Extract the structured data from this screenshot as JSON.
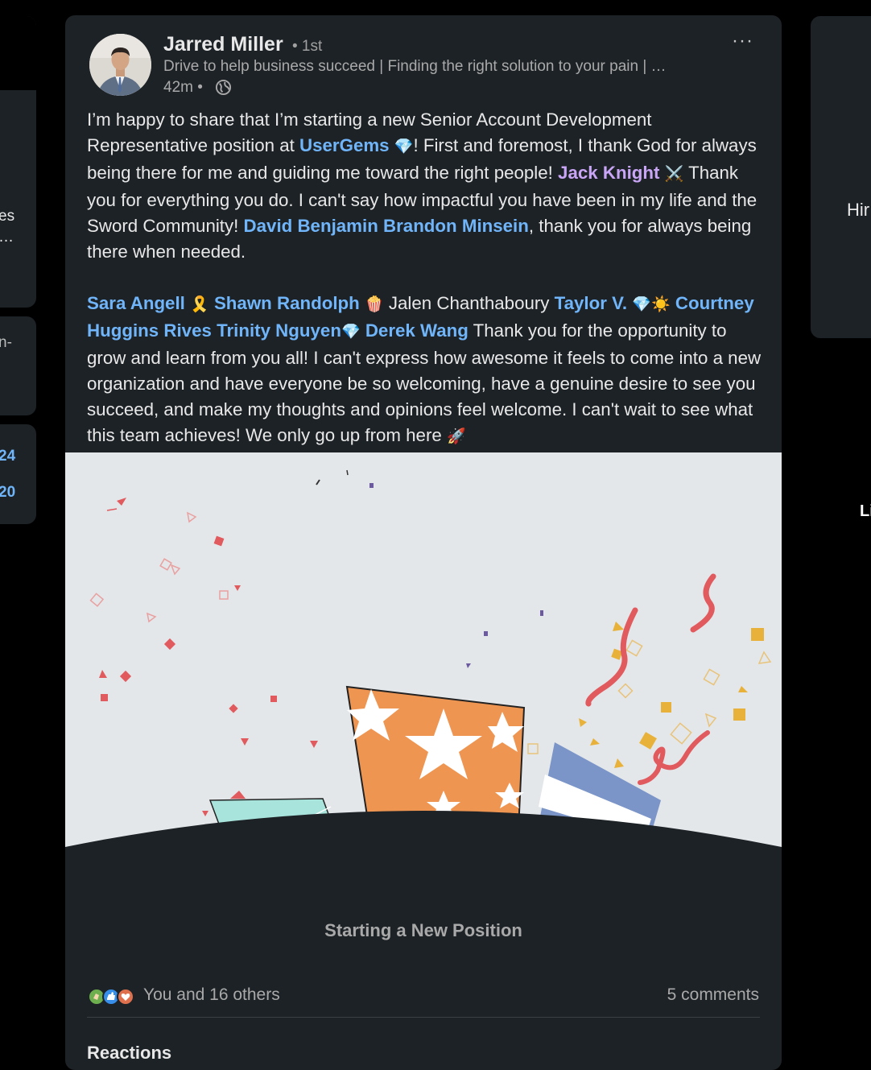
{
  "left": {
    "card1_line1": "es",
    "card1_line2": "…",
    "card2_line1": "n-",
    "card3_num1": "24",
    "card3_num2": "20"
  },
  "right": {
    "card_text": "Hir",
    "below_text": "Li"
  },
  "post": {
    "author": "Jarred Miller",
    "degree": "• 1st",
    "headline": "Drive to help business succeed | Finding the right solution to your pain | …",
    "time": "42m •",
    "more": "···",
    "p1": {
      "t1": "I’m happy to share that I’m starting a new Senior Account Development Representative position at ",
      "m1": "UserGems",
      "e1": "💎",
      "t2": "! First and foremost, I thank God for always being there for me and guiding me toward the right people! ",
      "m2": "Jack Knight",
      "e2": "⚔️",
      "t3": " Thank you for everything you do. I can't say how impactful you have been in my life and the Sword Community! ",
      "m3": "David Benjamin Brandon Minsein",
      "t4": ", thank you for always being there when needed."
    },
    "p2": {
      "m1": "Sara Angell",
      "e1": "🎗️",
      "m2": "Shawn Randolph",
      "e2": "🍿",
      "t1": " Jalen Chanthaboury ",
      "m3": "Taylor V.",
      "e3": "💎☀️",
      "m4": "Courtney Huggins Rives",
      "m5": "Trinity Nguyen",
      "e4": "💎",
      "m6": "Derek Wang",
      "t2": " Thank you for the opportunity to grow and learn from you all! I can't express how awesome it feels to come into a new organization and have everyone be so welcoming, have a genuine desire to see you succeed, and make my thoughts and opinions feel welcome. I can't wait to see what this team achieves! We only go up from here ",
      "e5": "🚀"
    },
    "caption": "Starting a New Position",
    "reactions": "You and 16 others",
    "comments": "5 comments",
    "section": "Reactions"
  },
  "colors": {
    "background": "#000000",
    "card": "#1d2226",
    "link": "#70b5f9",
    "visited_link": "#c9a5f5",
    "banner_bg": "#e4e7ea",
    "star_cup": "#ef9552",
    "mint_cup": "#a8e4dc",
    "blue_cup": "#7b95c8",
    "streamer": "#e05a5e",
    "confetti_gold": "#e8b23a"
  }
}
